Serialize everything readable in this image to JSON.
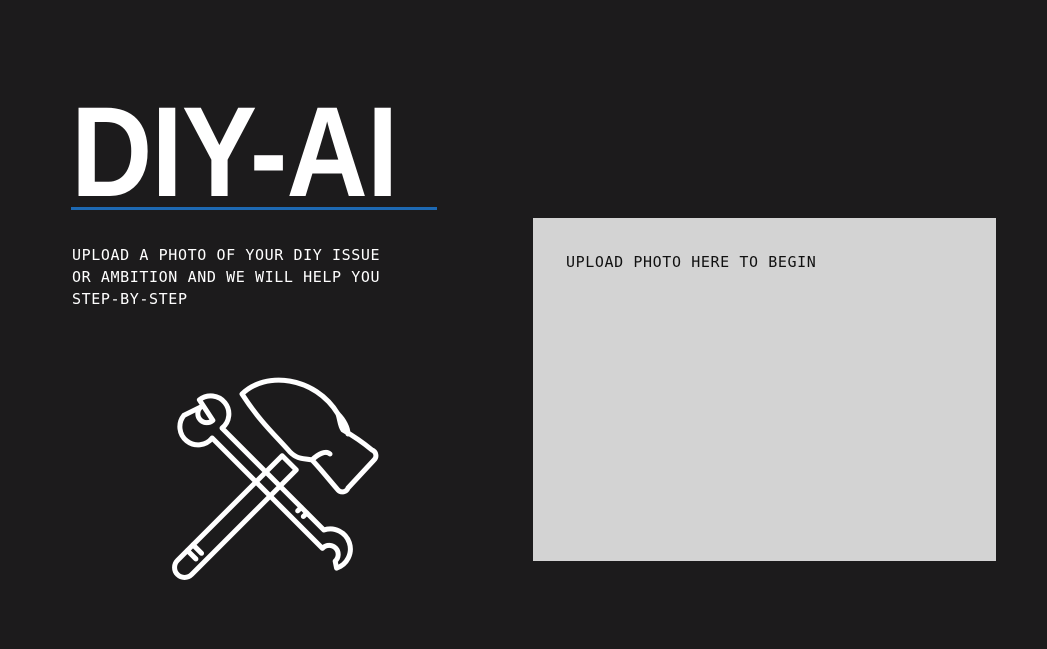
{
  "hero": {
    "title": "DIY-AI",
    "tagline": "UPLOAD A PHOTO OF YOUR DIY ISSUE OR AMBITION AND WE WILL HELP YOU STEP-BY-STEP"
  },
  "upload": {
    "prompt": "UPLOAD PHOTO HERE TO BEGIN"
  },
  "illustration": {
    "icon": "hammer-and-wrench-icon"
  },
  "colors": {
    "background": "#1c1b1c",
    "accent_underline": "#1d69b3",
    "dropzone": "#d3d3d3",
    "text": "#ffffff"
  }
}
